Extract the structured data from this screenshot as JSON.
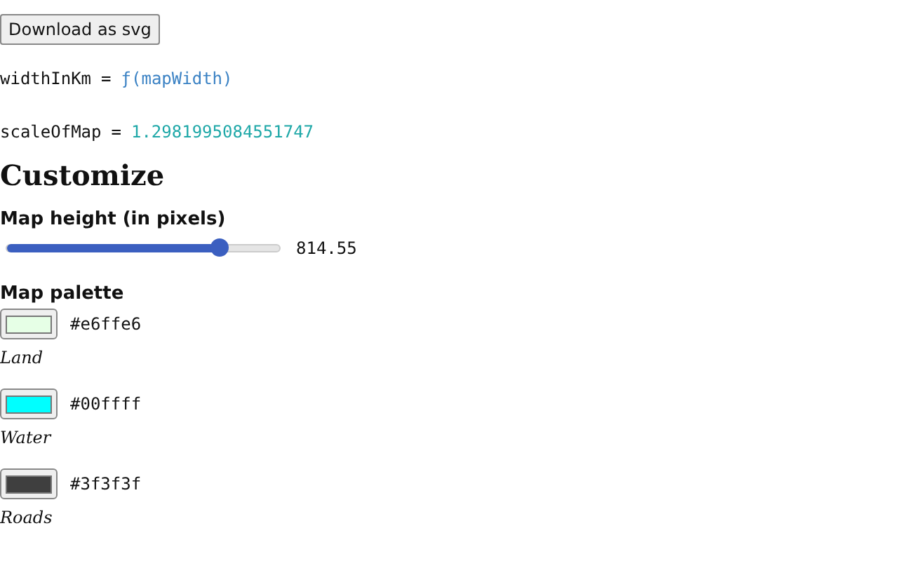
{
  "download_button": "Download as svg",
  "code_lines": [
    {
      "name": "widthInKm",
      "op": "=",
      "value": "ƒ(mapWidth)",
      "kind": "function"
    },
    {
      "name": "scaleOfMap",
      "op": "=",
      "value": "1.2981995084551747",
      "kind": "number"
    }
  ],
  "heading": "Customize",
  "map_height": {
    "label": "Map height (in pixels)",
    "level": 0.78,
    "reading": "814.55"
  },
  "palette": {
    "label": "Map palette",
    "items": [
      {
        "color": "#e6ffe6",
        "hex": "#e6ffe6",
        "name": "Land"
      },
      {
        "color": "#00ffff",
        "hex": "#00ffff",
        "name": "Water"
      },
      {
        "color": "#3f3f3f",
        "hex": "#3f3f3f",
        "name": "Roads"
      }
    ]
  }
}
